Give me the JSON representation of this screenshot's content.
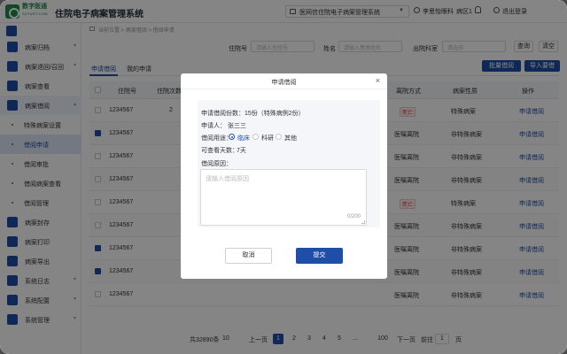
{
  "header": {
    "logo_cn": "数字医通",
    "logo_en": "SZYUST.COM",
    "app_title": "住院电子病案管理系统",
    "system_select": "医网信住院电子病案管理系统",
    "user_name": "李思怡",
    "dept": "眼科",
    "ward": "病区1",
    "logout": "退出登录"
  },
  "sidebar": {
    "items": [
      {
        "label": "病案归档"
      },
      {
        "label": "病案退回/召回"
      },
      {
        "label": "病案查看"
      },
      {
        "label": "病案借阅"
      },
      {
        "label": "病案封存"
      },
      {
        "label": "病案打印"
      },
      {
        "label": "病案导出"
      },
      {
        "label": "系统日志"
      },
      {
        "label": "系统配置"
      },
      {
        "label": "系统管理"
      }
    ],
    "subitems": [
      {
        "label": "特殊病案设置"
      },
      {
        "label": "借阅申请"
      },
      {
        "label": "借阅审批"
      },
      {
        "label": "借阅病案查看"
      },
      {
        "label": "借阅管理"
      }
    ]
  },
  "breadcrumb": {
    "text": "当前位置 > 病案借阅 > 借阅申请"
  },
  "filters": {
    "inpatient_label": "住院号",
    "inpatient_placeholder": "请输入住院号",
    "name_label": "姓名",
    "name_placeholder": "请输入患者姓名",
    "dept_label": "出院科室",
    "dept_placeholder": "请选择",
    "query_btn": "查询",
    "clear_btn": "清空"
  },
  "tabs": [
    {
      "label": "申请借阅"
    },
    {
      "label": "我的申请"
    }
  ],
  "actions": {
    "batch_btn": "批量借阅",
    "import_btn": "导入要借"
  },
  "table": {
    "headers": {
      "no": "住院号",
      "times": "住院次数",
      "discharge": "离院方式",
      "nature": "病案性质",
      "op": "操作"
    },
    "rows": [
      {
        "no": "1234567",
        "times": "2",
        "discharge": "死亡",
        "discharge_tag": true,
        "nature": "特殊病案",
        "op": "申请借阅",
        "checked": false
      },
      {
        "no": "1234567",
        "times": "",
        "discharge": "医嘱离院",
        "discharge_tag": false,
        "nature": "非特殊病案",
        "op": "申请借阅",
        "checked": true
      },
      {
        "no": "1234567",
        "times": "",
        "discharge": "医嘱离院",
        "discharge_tag": false,
        "nature": "非特殊病案",
        "op": "申请借阅",
        "checked": false
      },
      {
        "no": "1234567",
        "times": "",
        "discharge": "医嘱离院",
        "discharge_tag": false,
        "nature": "非特殊病案",
        "op": "申请借阅",
        "checked": false
      },
      {
        "no": "1234567",
        "times": "",
        "discharge": "死亡",
        "discharge_tag": true,
        "nature": "特殊病案",
        "op": "申请借阅",
        "checked": false
      },
      {
        "no": "1234567",
        "times": "",
        "discharge": "医嘱离院",
        "discharge_tag": false,
        "nature": "非特殊病案",
        "op": "申请借阅",
        "checked": false
      },
      {
        "no": "1234567",
        "times": "",
        "discharge": "医嘱离院",
        "discharge_tag": false,
        "nature": "非特殊病案",
        "op": "申请借阅",
        "checked": true
      },
      {
        "no": "1234567",
        "times": "",
        "discharge": "医嘱离院",
        "discharge_tag": false,
        "nature": "非特殊病案",
        "op": "申请借阅",
        "checked": true
      },
      {
        "no": "1234567",
        "times": "",
        "discharge": "医嘱离院",
        "discharge_tag": false,
        "nature": "非特殊病案",
        "op": "申请借阅",
        "checked": false
      }
    ]
  },
  "pager": {
    "total": "共32890条",
    "size": "10",
    "prev": "上一页",
    "pages": [
      "1",
      "2",
      "3",
      "4",
      "5",
      "...",
      "100"
    ],
    "next": "下一页",
    "goto_label": "前往",
    "goto_value": "1",
    "goto_unit": "页"
  },
  "modal": {
    "title": "申请借阅",
    "close": "×",
    "count": "申请借阅份数：15份（特殊病例2份）",
    "applicant_label": "申请人：",
    "applicant": "张三三",
    "purpose_label": "借阅用途：",
    "purpose_options": [
      "临床",
      "科研",
      "其他"
    ],
    "days_label": "可查看天数：",
    "days": "7天",
    "reason_label": "借阅原因：",
    "reason_placeholder": "请输入借阅原因",
    "counter": "0/200",
    "cancel": "取消",
    "submit": "提交"
  }
}
